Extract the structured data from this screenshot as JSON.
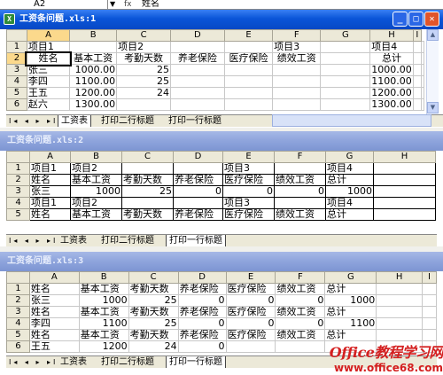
{
  "formula_bar": {
    "cell_ref": "A2",
    "fx": "fx",
    "value": "姓名"
  },
  "windows": [
    {
      "title": "工资条问题.xls:1",
      "active": true,
      "col_headers": [
        "",
        "A",
        "B",
        "C",
        "D",
        "E",
        "F",
        "G",
        "H",
        "I"
      ],
      "rows": [
        {
          "n": "1",
          "cells": [
            "项目1",
            "",
            "项目2",
            "",
            "",
            "项目3",
            "",
            "项目4",
            "",
            ""
          ]
        },
        {
          "n": "2",
          "cells": [
            "姓名",
            "基本工资",
            "考勤天数",
            "养老保险",
            "医疗保险",
            "绩效工资",
            "",
            "总计",
            "",
            ""
          ]
        },
        {
          "n": "3",
          "cells": [
            "张三",
            "1000.00",
            "25",
            "",
            "",
            "",
            "",
            "1000.00",
            "",
            ""
          ]
        },
        {
          "n": "4",
          "cells": [
            "李四",
            "1100.00",
            "25",
            "",
            "",
            "",
            "",
            "1100.00",
            "",
            ""
          ]
        },
        {
          "n": "5",
          "cells": [
            "王五",
            "1200.00",
            "24",
            "",
            "",
            "",
            "",
            "1200.00",
            "",
            ""
          ]
        },
        {
          "n": "6",
          "cells": [
            "赵六",
            "1300.00",
            "",
            "",
            "",
            "",
            "",
            "1300.00",
            "",
            ""
          ]
        }
      ],
      "tabs": [
        "工资表",
        "打印二行标题",
        "打印一行标题"
      ]
    },
    {
      "title": "工资条问题.xls:2",
      "active": false,
      "col_headers": [
        "",
        "A",
        "B",
        "C",
        "D",
        "E",
        "F",
        "G",
        "H"
      ],
      "rows": [
        {
          "n": "1",
          "cells": [
            "项目1",
            "项目2",
            "",
            "",
            "项目3",
            "",
            "项目4",
            ""
          ]
        },
        {
          "n": "2",
          "cells": [
            "姓名",
            "基本工资",
            "考勤天数",
            "养老保险",
            "医疗保险",
            "绩效工资",
            "总计",
            ""
          ]
        },
        {
          "n": "3",
          "cells": [
            "张三",
            "1000",
            "25",
            "0",
            "0",
            "0",
            "1000",
            ""
          ]
        },
        {
          "n": "4",
          "cells": [
            "项目1",
            "项目2",
            "",
            "",
            "项目3",
            "",
            "项目4",
            ""
          ]
        },
        {
          "n": "5",
          "cells": [
            "姓名",
            "基本工资",
            "考勤天数",
            "养老保险",
            "医疗保险",
            "绩效工资",
            "总计",
            ""
          ]
        }
      ],
      "tabs": [
        "工资表",
        "打印二行标题",
        "打印一行标题"
      ]
    },
    {
      "title": "工资条问题.xls:3",
      "active": false,
      "col_headers": [
        "",
        "A",
        "B",
        "C",
        "D",
        "E",
        "F",
        "G",
        "H",
        "I"
      ],
      "rows": [
        {
          "n": "1",
          "cells": [
            "姓名",
            "基本工资",
            "考勤天数",
            "养老保险",
            "医疗保险",
            "绩效工资",
            "总计",
            "",
            ""
          ]
        },
        {
          "n": "2",
          "cells": [
            "张三",
            "1000",
            "25",
            "0",
            "0",
            "0",
            "1000",
            "",
            ""
          ]
        },
        {
          "n": "3",
          "cells": [
            "姓名",
            "基本工资",
            "考勤天数",
            "养老保险",
            "医疗保险",
            "绩效工资",
            "总计",
            "",
            ""
          ]
        },
        {
          "n": "4",
          "cells": [
            "李四",
            "1100",
            "25",
            "0",
            "0",
            "0",
            "1100",
            "",
            ""
          ]
        },
        {
          "n": "5",
          "cells": [
            "姓名",
            "基本工资",
            "考勤天数",
            "养老保险",
            "医疗保险",
            "绩效工资",
            "总计",
            "",
            ""
          ]
        },
        {
          "n": "6",
          "cells": [
            "王五",
            "1200",
            "24",
            "0",
            "",
            "",
            "",
            "",
            ""
          ]
        }
      ],
      "tabs": [
        "工资表",
        "打印二行标题",
        "打印一行标题"
      ]
    }
  ],
  "window_buttons": {
    "minimize": "_",
    "maximize": "□",
    "close": "✕"
  },
  "nav_buttons": "I◂ ◂ ▸ ▸I",
  "watermark": {
    "line1": "Office教程学习网",
    "line2": "www.office68.com"
  },
  "colors": {
    "titlebar_active": "#0a55d8",
    "titlebar_inactive": "#8ea4dc",
    "watermark": "#d42020"
  }
}
